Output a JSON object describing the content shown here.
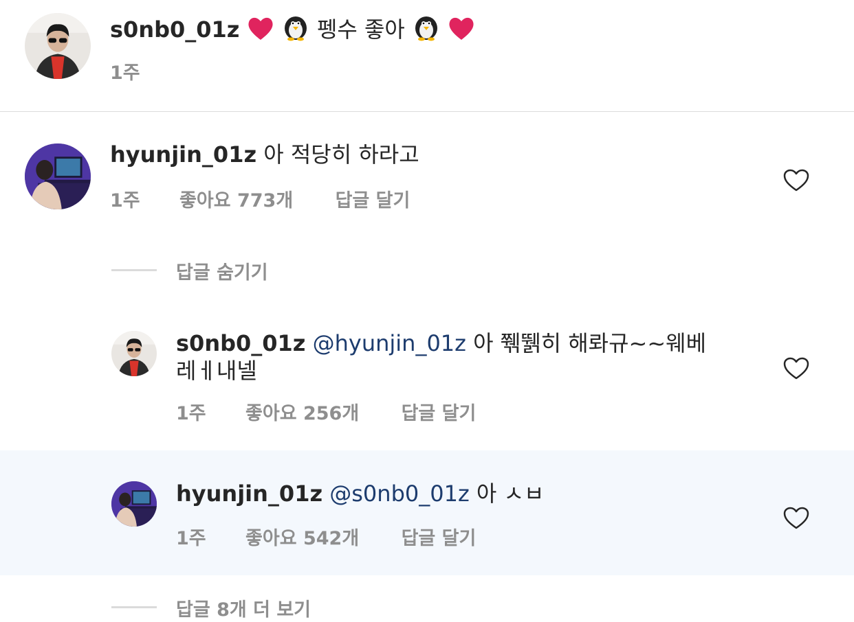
{
  "caption": {
    "username": "s0nb0_01z",
    "emoji_left": [
      "red-heart",
      "penguin"
    ],
    "text": "펭수 좋아",
    "emoji_right": [
      "penguin",
      "red-heart"
    ],
    "time": "1주"
  },
  "comments": [
    {
      "username": "hyunjin_01z",
      "text": "아 적당히 하라고",
      "time": "1주",
      "likes": "좋아요 773개",
      "reply": "답글 달기"
    }
  ],
  "hide_replies": "답글 숨기기",
  "replies": [
    {
      "username": "s0nb0_01z",
      "mention": "@hyunjin_01z",
      "text_line1": "아 쮂뛝히 해롸규~~웨베",
      "text_line2": "레ㅔ내넬",
      "time": "1주",
      "likes": "좋아요 256개",
      "reply": "답글 달기"
    },
    {
      "username": "hyunjin_01z",
      "mention": "@s0nb0_01z",
      "text": "아 ㅅㅂ",
      "time": "1주",
      "likes": "좋아요 542개",
      "reply": "답글 달기"
    }
  ],
  "view_more": "답글 8개 더 보기",
  "colors": {
    "accent_mention": "#1d3c6e",
    "muted": "#8e8e8e",
    "highlight_bg": "#f4f8fd",
    "heart_red": "#e0245e"
  }
}
